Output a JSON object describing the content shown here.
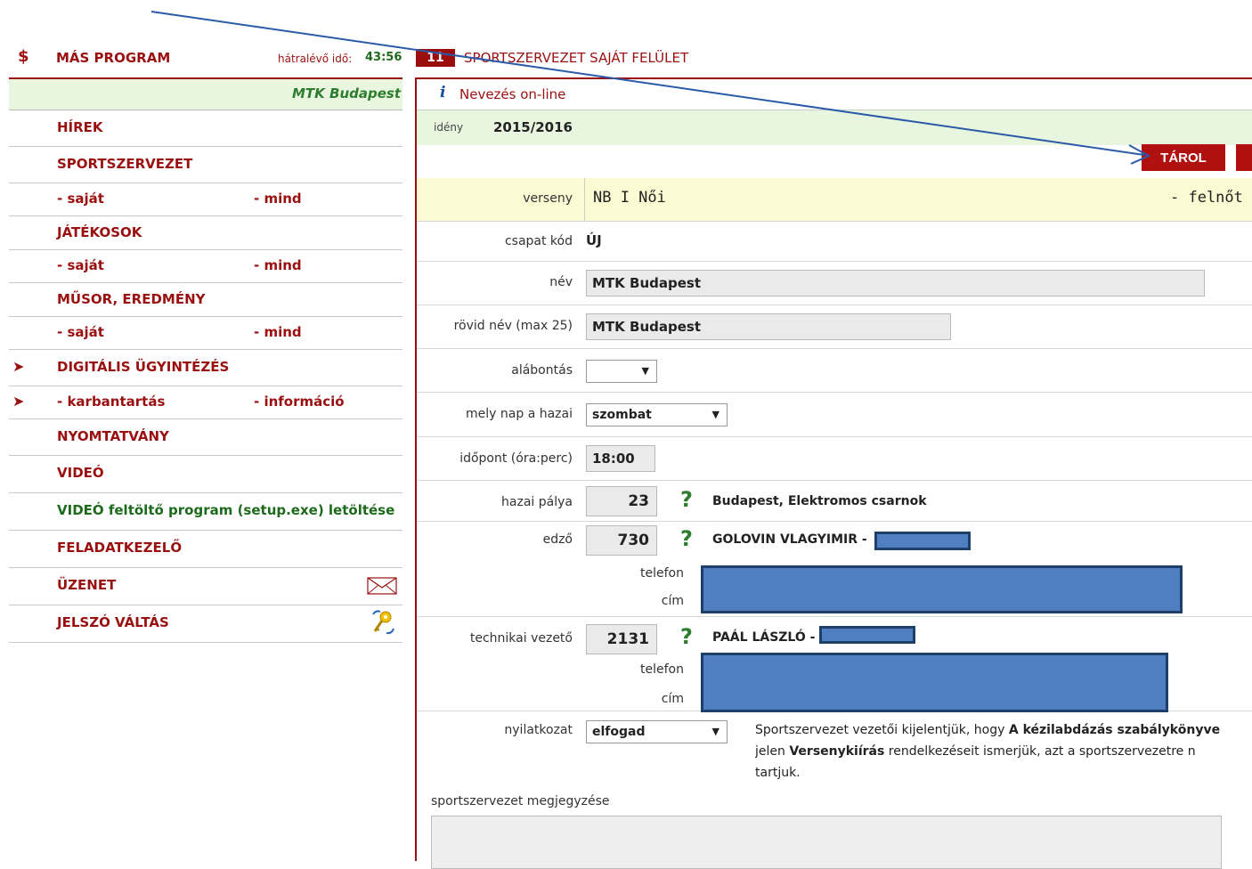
{
  "topbar": {
    "dollar_icon": "dollar-swap-icon",
    "program_label": "MÁS PROGRAM",
    "time_label": "hátralévő idő:",
    "time_value": "43:56",
    "tab_number": "11",
    "title": "SPORTSZERVEZET SAJÁT FELÜLET"
  },
  "sidebar": {
    "club_name": "MTK Budapest",
    "items": [
      {
        "label": "HÍREK"
      },
      {
        "label": "SPORTSZERVEZET"
      },
      {
        "label": "- saját",
        "label2": "- mind"
      },
      {
        "label": "JÁTÉKOSOK"
      },
      {
        "label": "- saját",
        "label2": "- mind"
      },
      {
        "label": "MŰSOR, EREDMÉNY"
      },
      {
        "label": "- saját",
        "label2": "- mind"
      },
      {
        "label": "DIGITÁLIS ÜGYINTÉZÉS",
        "arrow": "➤"
      },
      {
        "label": "- karbantartás",
        "label2": "- információ",
        "arrow": "➤"
      },
      {
        "label": "NYOMTATVÁNY"
      },
      {
        "label": "VIDEÓ"
      },
      {
        "label": "VIDEÓ feltöltő program (setup.exe) letöltése"
      },
      {
        "label": "FELADATKEZELŐ"
      },
      {
        "label": "ÜZENET",
        "icon": "envelope-icon"
      },
      {
        "label": "JELSZÓ VÁLTÁS",
        "icon": "keys-icon"
      }
    ]
  },
  "main": {
    "info_icon": "i",
    "title": "Nevezés on-line",
    "season_label": "idény",
    "season_value": "2015/2016",
    "save_button": "TÁROL",
    "form": {
      "competition_label": "verseny",
      "competition_value": "NB I Női",
      "competition_category": "- felnőt",
      "team_code_label": "csapat kód",
      "team_code_value": "ÚJ",
      "name_label": "név",
      "name_value": "MTK Budapest",
      "short_name_label": "rövid név (max 25)",
      "short_name_value": "MTK Budapest",
      "subdivision_label": "alábontás",
      "subdivision_value": "",
      "home_day_label": "mely nap a hazai",
      "home_day_value": "szombat",
      "time_label": "időpont (óra:perc)",
      "time_value": "18:00",
      "venue_label": "hazai pálya",
      "venue_code": "23",
      "venue_name": "Budapest, Elektromos csarnok",
      "coach_label": "edző",
      "coach_code": "730",
      "coach_name": "GOLOVIN VLAGYIMIR -",
      "coach_phone_label": "telefon",
      "coach_address_label": "cím",
      "tech_label": "technikai vezető",
      "tech_code": "2131",
      "tech_name": "PAÁL LÁSZLÓ -",
      "tech_phone_label": "telefon",
      "tech_address_label": "cím",
      "declaration_label": "nyilatkozat",
      "declaration_value": "elfogad",
      "declaration_text_1": "Sportszervezet vezetői kijelentjük, hogy ",
      "declaration_bold_1": "A kézilabdázás szabálykönyve",
      "declaration_text_2": "jelen ",
      "declaration_bold_2": "Versenykiírás",
      "declaration_text_3": " rendelkezéseit ismerjük, azt a sportszervezetre n",
      "declaration_text_4": "tartjuk.",
      "notes_label": "sportszervezet megjegyzése"
    }
  },
  "colors": {
    "brand_red": "#9a0e0e",
    "green": "#2e7d2e",
    "light_green": "#e8f6e0",
    "redaction_blue": "#4f7fc1"
  }
}
